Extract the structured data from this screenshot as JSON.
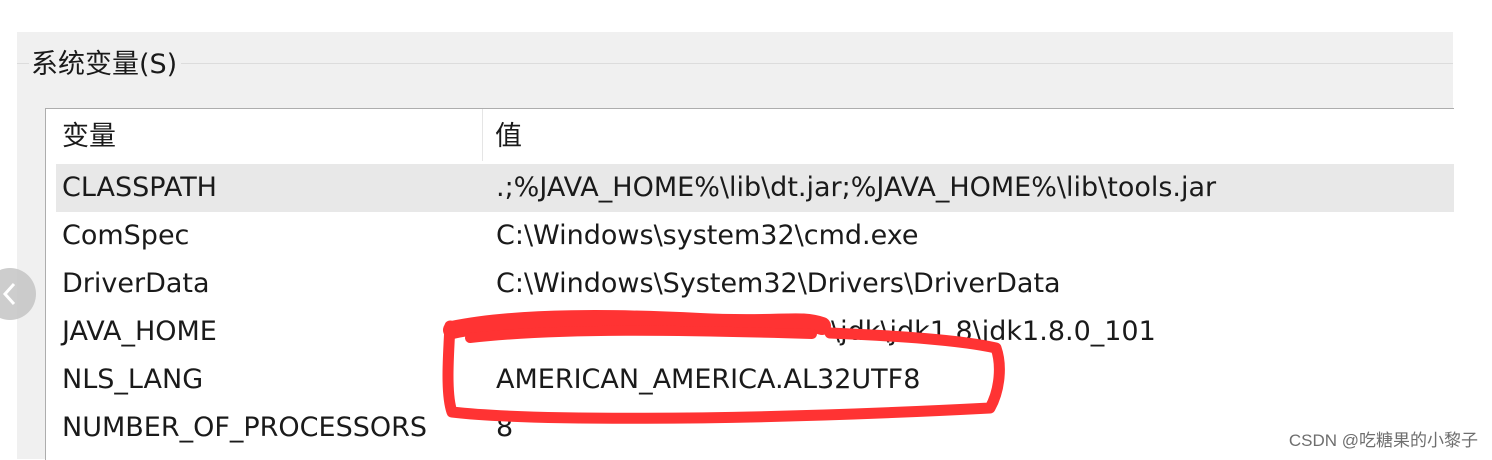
{
  "group": {
    "title": "系统变量(S)"
  },
  "table": {
    "columns": [
      "变量",
      "值"
    ],
    "rows": [
      {
        "name": "CLASSPATH",
        "value": ".;%JAVA_HOME%\\lib\\dt.jar;%JAVA_HOME%\\lib\\tools.jar"
      },
      {
        "name": "ComSpec",
        "value": "C:\\Windows\\system32\\cmd.exe"
      },
      {
        "name": "DriverData",
        "value": "C:\\Windows\\System32\\Drivers\\DriverData"
      },
      {
        "name": "JAVA_HOME",
        "value": "\\jdk\\jdk1.8\\jdk1.8.0_101"
      },
      {
        "name": "NLS_LANG",
        "value": "AMERICAN_AMERICA.AL32UTF8"
      },
      {
        "name": "NUMBER_OF_PROCESSORS",
        "value": "8"
      }
    ]
  },
  "colors": {
    "annotation": "#ff3333",
    "panel": "#f0f0f0",
    "stripe": "#e8e8e8"
  },
  "icons": {
    "nav": "chevron-left-icon"
  },
  "watermark": "CSDN @吃糖果的小黎子"
}
